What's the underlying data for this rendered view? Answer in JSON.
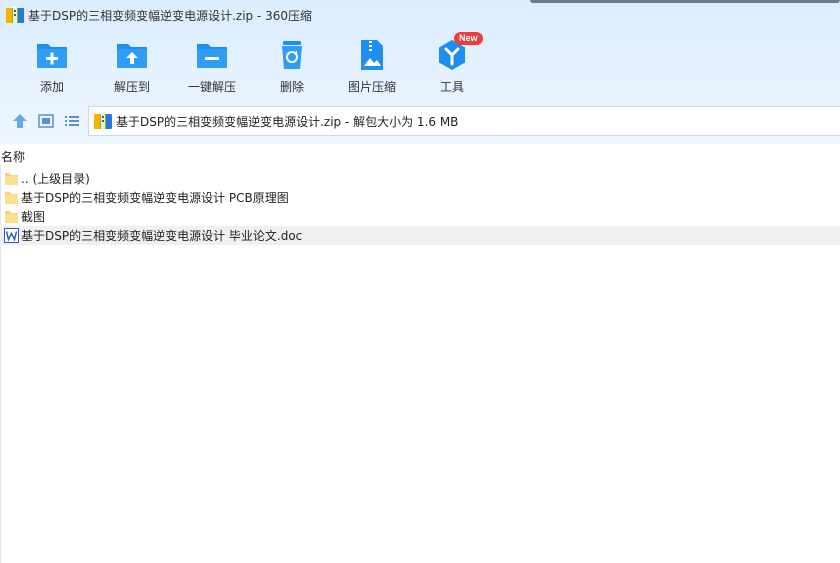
{
  "window": {
    "title": "基于DSP的三相变频变幅逆变电源设计.zip - 360压缩"
  },
  "toolbar": {
    "items": [
      {
        "label": "添加",
        "icon": "folder-plus-icon"
      },
      {
        "label": "解压到",
        "icon": "folder-upload-icon"
      },
      {
        "label": "一键解压",
        "icon": "folder-minus-icon"
      },
      {
        "label": "删除",
        "icon": "recycle-bin-icon"
      },
      {
        "label": "图片压缩",
        "icon": "image-zip-icon"
      },
      {
        "label": "工具",
        "icon": "tools-icon"
      }
    ],
    "new_badge": "New"
  },
  "nav": {
    "path": "基于DSP的三相变频变幅逆变电源设计.zip - 解包大小为 1.6 MB"
  },
  "list": {
    "column_name": "名称",
    "items": [
      {
        "name": ".. (上级目录)",
        "type": "folder",
        "selected": false
      },
      {
        "name": "基于DSP的三相变频变幅逆变电源设计 PCB原理图",
        "type": "folder",
        "selected": false
      },
      {
        "name": "截图",
        "type": "folder",
        "selected": false
      },
      {
        "name": "基于DSP的三相变频变幅逆变电源设计 毕业论文.doc",
        "type": "doc",
        "selected": true
      }
    ]
  },
  "colors": {
    "accent": "#1e8ff0",
    "chrome_bg": "#dcedfd",
    "badge": "#f23c3c"
  }
}
